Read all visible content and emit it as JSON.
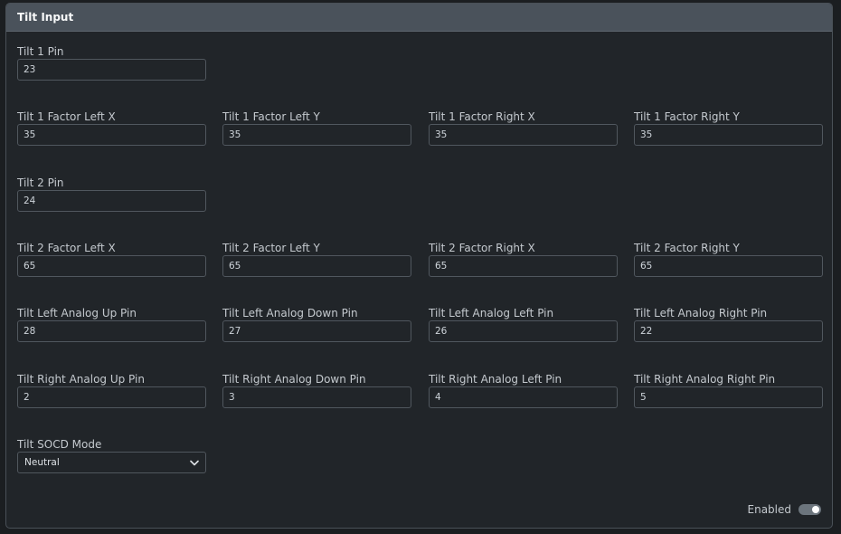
{
  "card": {
    "title": "Tilt Input"
  },
  "fields": {
    "tilt1_pin": {
      "label": "Tilt 1 Pin",
      "value": "23"
    },
    "tilt1_factor_left_x": {
      "label": "Tilt 1 Factor Left X",
      "value": "35"
    },
    "tilt1_factor_left_y": {
      "label": "Tilt 1 Factor Left Y",
      "value": "35"
    },
    "tilt1_factor_right_x": {
      "label": "Tilt 1 Factor Right X",
      "value": "35"
    },
    "tilt1_factor_right_y": {
      "label": "Tilt 1 Factor Right Y",
      "value": "35"
    },
    "tilt2_pin": {
      "label": "Tilt 2 Pin",
      "value": "24"
    },
    "tilt2_factor_left_x": {
      "label": "Tilt 2 Factor Left X",
      "value": "65"
    },
    "tilt2_factor_left_y": {
      "label": "Tilt 2 Factor Left Y",
      "value": "65"
    },
    "tilt2_factor_right_x": {
      "label": "Tilt 2 Factor Right X",
      "value": "65"
    },
    "tilt2_factor_right_y": {
      "label": "Tilt 2 Factor Right Y",
      "value": "65"
    },
    "left_analog_up_pin": {
      "label": "Tilt Left Analog Up Pin",
      "value": "28"
    },
    "left_analog_down_pin": {
      "label": "Tilt Left Analog Down Pin",
      "value": "27"
    },
    "left_analog_left_pin": {
      "label": "Tilt Left Analog Left Pin",
      "value": "26"
    },
    "left_analog_right_pin": {
      "label": "Tilt Left Analog Right Pin",
      "value": "22"
    },
    "right_analog_up_pin": {
      "label": "Tilt Right Analog Up Pin",
      "value": "2"
    },
    "right_analog_down_pin": {
      "label": "Tilt Right Analog Down Pin",
      "value": "3"
    },
    "right_analog_left_pin": {
      "label": "Tilt Right Analog Left Pin",
      "value": "4"
    },
    "right_analog_right_pin": {
      "label": "Tilt Right Analog Right Pin",
      "value": "5"
    },
    "socd_mode": {
      "label": "Tilt SOCD Mode",
      "value": "Neutral",
      "icon": "chevron-down-icon"
    }
  },
  "footer": {
    "enabled_label": "Enabled",
    "enabled": true
  }
}
